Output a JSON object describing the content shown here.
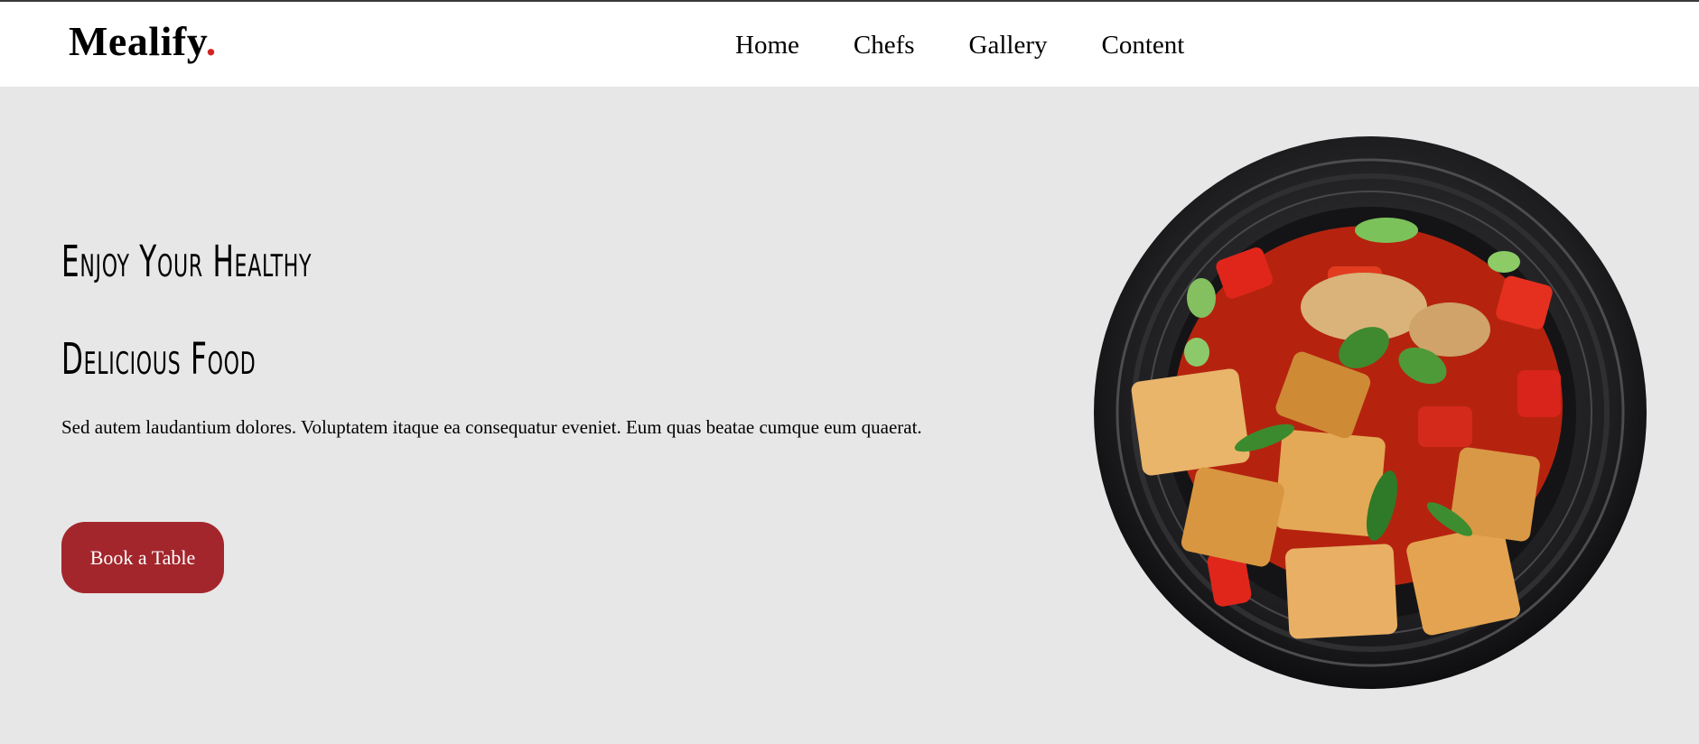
{
  "brand": {
    "name": "Mealify",
    "dot": ".",
    "accent_color": "#d32424"
  },
  "nav": {
    "items": [
      "Home",
      "Chefs",
      "Gallery",
      "Content"
    ]
  },
  "hero": {
    "title_line1": "Enjoy Your Healthy",
    "title_line2": "Delicious Food",
    "description": "Sed autem laudantium dolores. Voluptatem itaque ea consequatur eveniet. Eum quas beatae cumque eum quaerat.",
    "cta_label": "Book a Table",
    "cta_color": "#a3262c"
  },
  "dish_image": {
    "subject": "tofu and vegetable stir-fry in a black bowl"
  }
}
